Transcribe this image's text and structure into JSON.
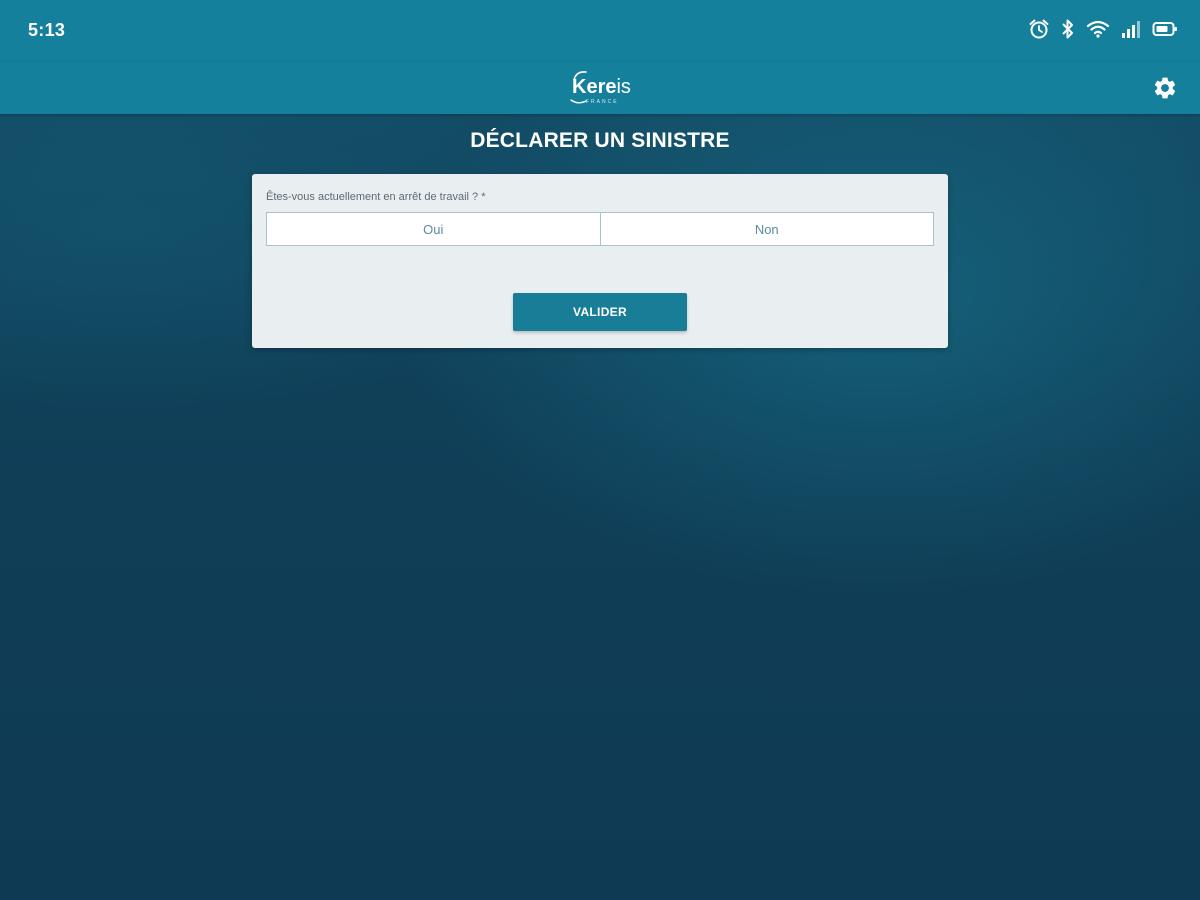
{
  "status_bar": {
    "time": "5:13",
    "icons": [
      "alarm-icon",
      "bluetooth-icon",
      "wifi-icon",
      "signal-icon",
      "battery-icon"
    ]
  },
  "app_bar": {
    "logo_text_bold": "Kere",
    "logo_text_light": "is",
    "logo_subtext": "FRANCE",
    "settings_icon": "gear-icon"
  },
  "page": {
    "title": "DÉCLARER UN SINISTRE"
  },
  "form": {
    "question": "Êtes-vous actuellement en arrêt de travail ? *",
    "options": [
      "Oui",
      "Non"
    ],
    "submit_label": "VALIDER"
  },
  "colors": {
    "bar": "#14809c",
    "background": "#0f3a53",
    "card": "#e9eef1",
    "accent": "#187d97",
    "option_text": "#5a8c9e"
  }
}
